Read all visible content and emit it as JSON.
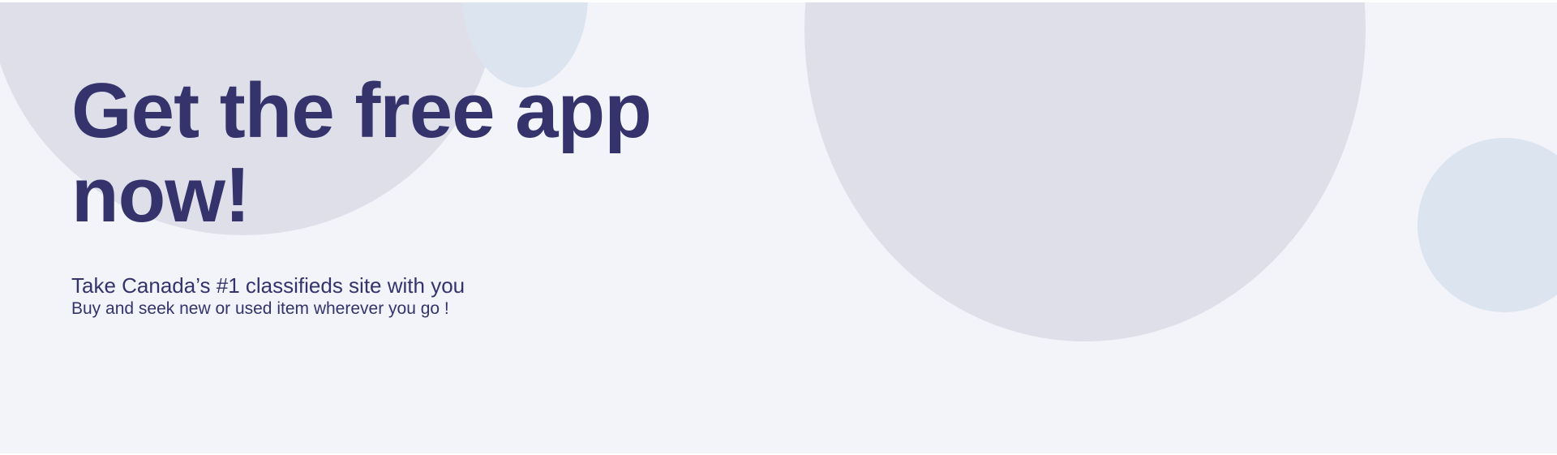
{
  "hero": {
    "headline": "Get the free app now!",
    "subtitle": "Take Canada’s #1 classifieds site with you",
    "tagline": "Buy and seek new or used item wherever you go !"
  },
  "colors": {
    "background": "#f3f4f9",
    "text": "#34336b",
    "circle_lavender": "#dfdfea",
    "circle_blue": "#dbe4ef"
  }
}
